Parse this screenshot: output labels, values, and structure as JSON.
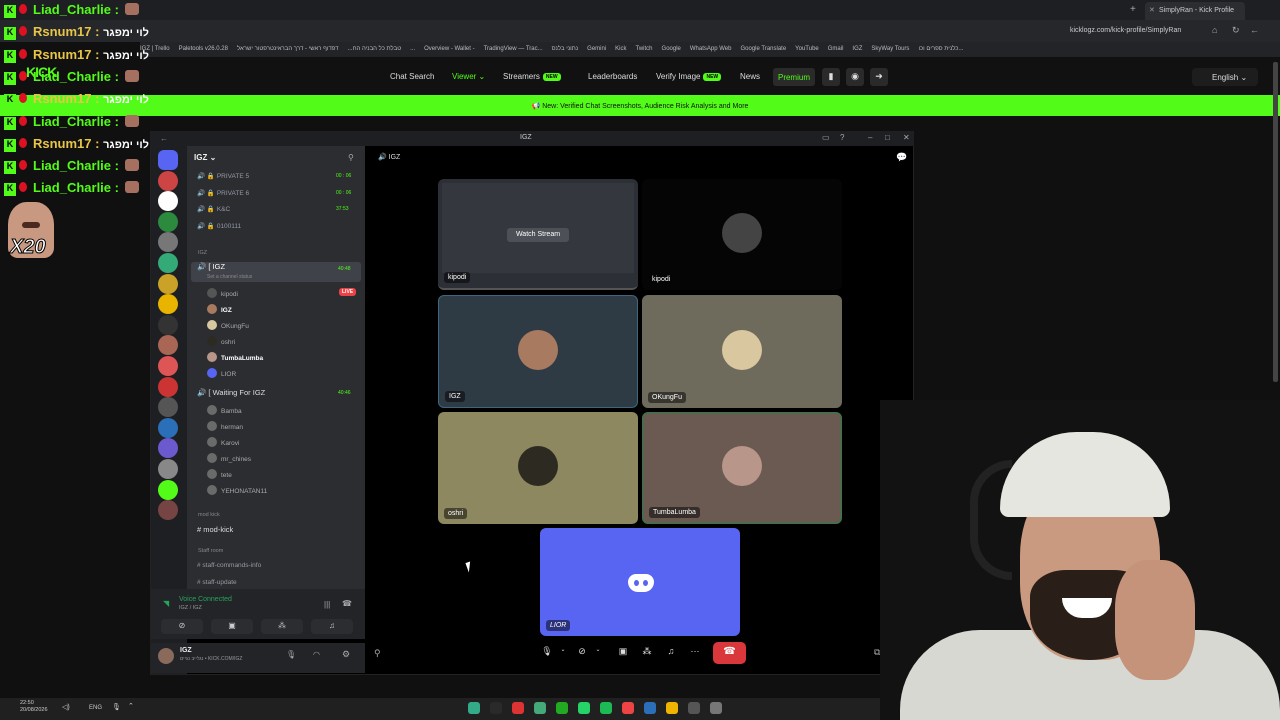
{
  "browser": {
    "tab_title": "SimplyRan - Kick Profile",
    "url": "kicklogz.com/kick-profile/SimplyRan",
    "bookmarks": [
      "IGZ | Trello",
      "Paletools v26.0.28",
      "טבלת כל הבניה הח...",
      "דפדוף ראשי - דרך הבר",
      "אינטרפטור ישראל...",
      "Overview - Wallet -",
      "TradingView — Trac...",
      "נתוני בלנס",
      "Gemini",
      "Kick",
      "Twitch",
      "Google",
      "WhatsApp Web",
      "Google Translate",
      "YouTube",
      "Gmail",
      "IGZ",
      "SkyWay Tours",
      "כלנית ספרים וכו..."
    ]
  },
  "site": {
    "nav": [
      "Chat Search",
      "Viewer",
      "Streamers",
      "Leaderboards",
      "Verify Image",
      "News"
    ],
    "new_badge": "NEW",
    "premium": "Premium",
    "language": "English",
    "banner": "New: Verified Chat Screenshots, Audience Risk Analysis and More"
  },
  "overlay": {
    "chat": [
      {
        "user": "Liad_Charlie :",
        "msg": ""
      },
      {
        "user": "Rsnum17 :",
        "msg": "לוי ימפגר"
      },
      {
        "user": "Rsnum17 :",
        "msg": "לוי ימפגר"
      },
      {
        "user": "Liad_Charlie :",
        "msg": ""
      },
      {
        "user": "Rsnum17 :",
        "msg": "לוי ימפגר"
      },
      {
        "user": "Liad_Charlie :",
        "msg": ""
      },
      {
        "user": "Rsnum17 :",
        "msg": "לוי ימפגר"
      },
      {
        "user": "Liad_Charlie :",
        "msg": ""
      },
      {
        "user": "Liad_Charlie :",
        "msg": ""
      }
    ],
    "logo": "KICK",
    "multiplier": "X20"
  },
  "discord": {
    "window_title": "IGZ",
    "server": "IGZ",
    "channels_top": [
      {
        "name": "PRIVATE 5",
        "time": "00 : 06"
      },
      {
        "name": "PRIVATE 6",
        "time": "00 : 06"
      },
      {
        "name": "K&C",
        "time": "37:53"
      },
      {
        "name": "0100111",
        "time": ""
      }
    ],
    "cat_igz": "IGZ",
    "active_channel": "IGZ",
    "active_time": "40:48",
    "channel_status": "Set a channel status",
    "live": "LIVE",
    "users": [
      "kipodi",
      "IGZ",
      "OKungFu",
      "oshri",
      "TumbaLumba",
      "LIOR"
    ],
    "waiting": "Waiting For IGZ",
    "waiting_time": "40:46",
    "waiting_users": [
      "Bamba",
      "herman",
      "Karovi",
      "mr_chines",
      "tete",
      "YEHONATAN11"
    ],
    "cat_mod": "mod kick",
    "mod_channel": "mod-kick",
    "cat_staff": "Staff room",
    "staff_channels": [
      "staff-commands-info",
      "staff-update"
    ],
    "voice_connected": "Voice Connected",
    "voice_sub": "IGZ / IGZ",
    "me": "IGZ",
    "me_status": "נגלייב נגיים • KICK.COM/IGZ",
    "stage_title": "IGZ",
    "watch_stream": "Watch Stream",
    "tiles": [
      "kipodi",
      "kipodi",
      "IGZ",
      "OKungFu",
      "oshri",
      "TumbaLumba",
      "LIOR"
    ]
  },
  "taskbar": {
    "time": "22:50",
    "date": "20/08/2026",
    "lang": "ENG"
  },
  "colors": {
    "kick_green": "#53fc18",
    "discord_blurple": "#5865f2",
    "hangup": "#da373c"
  }
}
